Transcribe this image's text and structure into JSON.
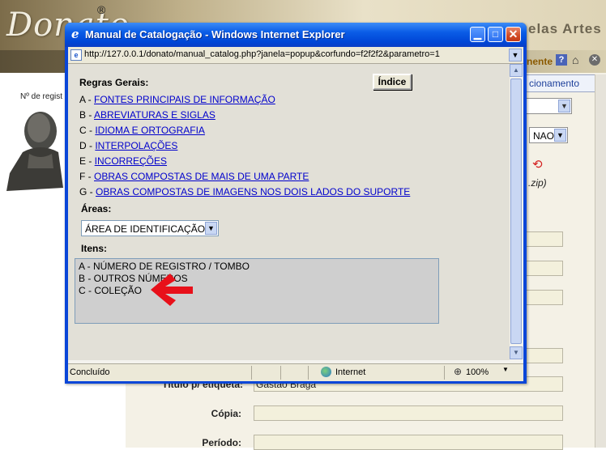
{
  "background": {
    "logo": "Donato",
    "registered_mark": "®",
    "header_right": "elas Artes",
    "bar_link": "nente",
    "regno_label": "Nº de regist",
    "tab_label": "cionamento",
    "nao_select": "NAO",
    "zip_text": ".zip)",
    "fields": {
      "titulo_label": "Título p/ etiqueta:",
      "titulo_value": "Gastão Braga",
      "copia_label": "Cópia:",
      "periodo_label": "Período:"
    }
  },
  "window": {
    "title": "Manual de Catalogação - Windows Internet Explorer",
    "address": "http://127.0.0.1/donato/manual_catalog.php?janela=popup&corfundo=f2f2f2&parametro=1",
    "status": "Concluído",
    "zone": "Internet",
    "zoom": "100%"
  },
  "page": {
    "heading_rules": "Regras Gerais:",
    "index_button": "Índice",
    "rules": [
      {
        "prefix": "A - ",
        "link": "FONTES PRINCIPAIS DE INFORMAÇÃO"
      },
      {
        "prefix": "B - ",
        "link": "ABREVIATURAS E SIGLAS"
      },
      {
        "prefix": "C - ",
        "link": "IDIOMA E ORTOGRAFIA"
      },
      {
        "prefix": "D - ",
        "link": "INTERPOLAÇÕES"
      },
      {
        "prefix": "E - ",
        "link": "INCORREÇÕES"
      },
      {
        "prefix": "F - ",
        "link": "OBRAS COMPOSTAS DE MAIS DE UMA PARTE"
      },
      {
        "prefix": "G - ",
        "link": "OBRAS COMPOSTAS DE IMAGENS NOS DOIS LADOS DO SUPORTE"
      }
    ],
    "heading_areas": "Áreas:",
    "area_selected": "ÁREA DE IDENTIFICAÇÃO",
    "heading_items": "Itens:",
    "items": [
      "A - NÚMERO DE REGISTRO / TOMBO",
      "B - OUTROS NÚMEROS",
      "C - COLEÇÃO"
    ]
  },
  "colors": {
    "titlebar": "#0a5ce6",
    "link": "#0000cc",
    "annotation_arrow": "#e8101a"
  }
}
